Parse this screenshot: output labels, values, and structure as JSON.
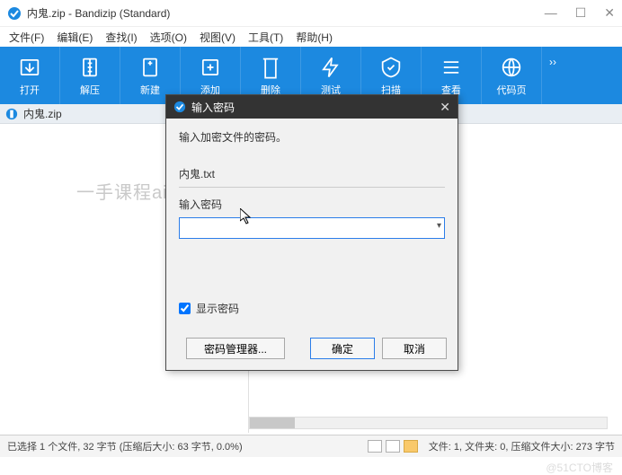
{
  "window": {
    "title": "内鬼.zip - Bandizip (Standard)"
  },
  "menu": {
    "file": "文件(F)",
    "edit": "编辑(E)",
    "find": "查找(I)",
    "options": "选项(O)",
    "view": "视图(V)",
    "tools": "工具(T)",
    "help": "帮助(H)"
  },
  "toolbar": {
    "open": "打开",
    "extract": "解压",
    "new": "新建",
    "add": "添加",
    "delete": "删除",
    "test": "测试",
    "scan": "扫描",
    "view": "查看",
    "codepage": "代码页",
    "more": "››"
  },
  "archive": {
    "filename": "内鬼.zip"
  },
  "watermark": "一手课程aixuexiit",
  "watermark_corner": "@51CTO博客",
  "dialog": {
    "title": "输入密码",
    "message": "输入加密文件的密码。",
    "filename": "内鬼.txt",
    "password_label": "输入密码",
    "password_value": "",
    "show_password": "显示密码",
    "password_manager": "密码管理器...",
    "ok": "确定",
    "cancel": "取消"
  },
  "status": {
    "left": "已选择 1 个文件, 32 字节 (压缩后大小: 63 字节, 0.0%)",
    "right": "文件: 1, 文件夹: 0, 压缩文件大小: 273 字节"
  }
}
